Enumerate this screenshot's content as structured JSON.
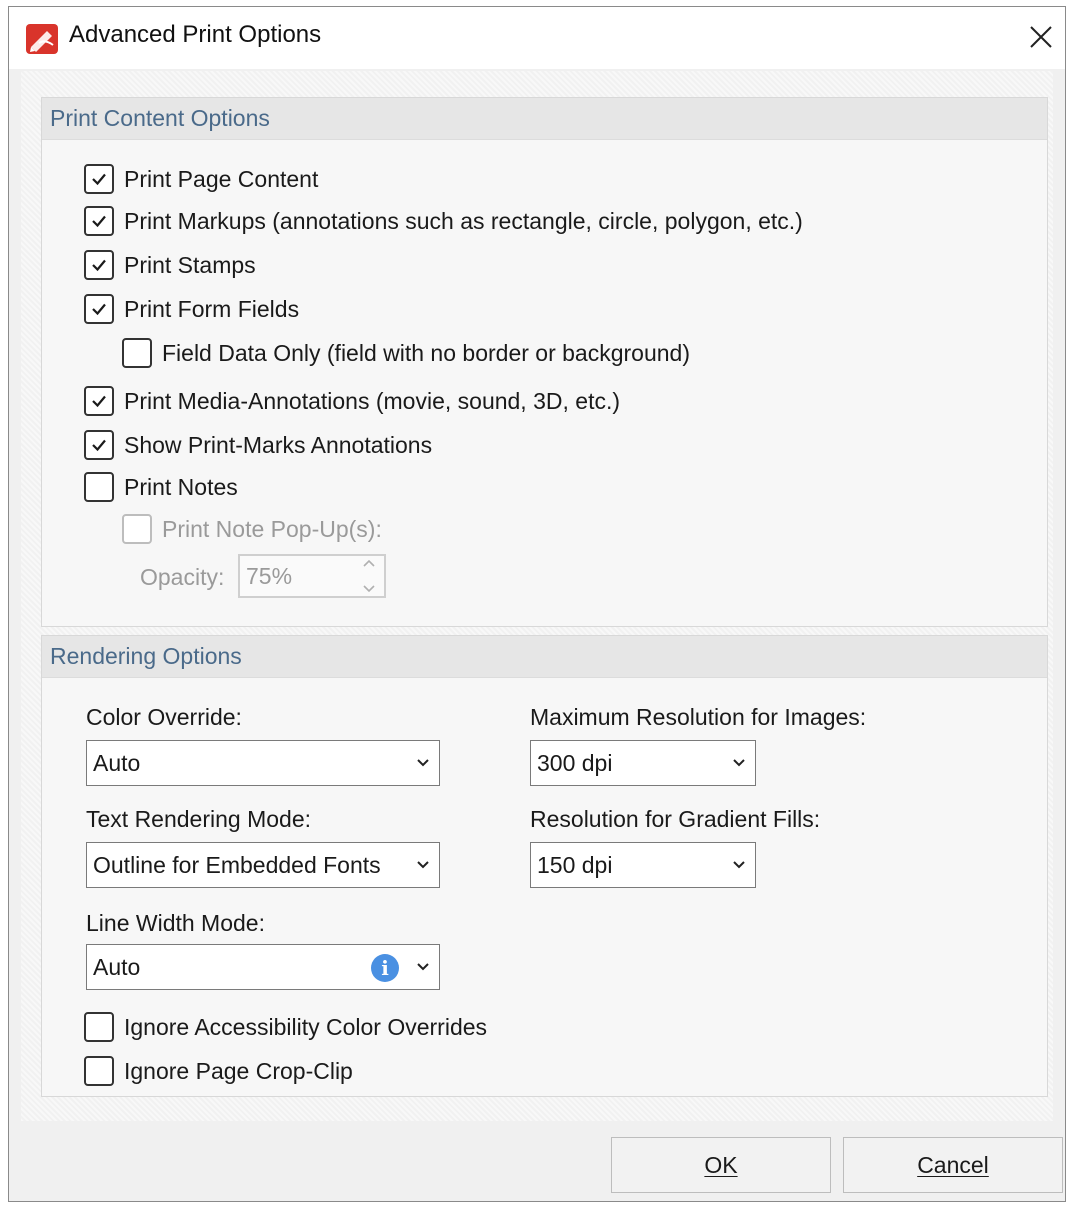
{
  "window": {
    "title": "Advanced Print Options",
    "app_icon": "pdf-app-icon",
    "close_icon": "close-icon"
  },
  "print_content": {
    "header": "Print Content Options",
    "items": [
      {
        "label": "Print Page Content",
        "checked": true,
        "disabled": false
      },
      {
        "label": "Print Markups (annotations such as rectangle, circle, polygon, etc.)",
        "checked": true,
        "disabled": false
      },
      {
        "label": "Print Stamps",
        "checked": true,
        "disabled": false
      },
      {
        "label": "Print Form Fields",
        "checked": true,
        "disabled": false
      },
      {
        "label": "Field Data Only (field with no border or background)",
        "checked": false,
        "disabled": false
      },
      {
        "label": "Print Media-Annotations (movie, sound, 3D, etc.)",
        "checked": true,
        "disabled": false
      },
      {
        "label": "Show Print-Marks Annotations",
        "checked": true,
        "disabled": false
      },
      {
        "label": "Print Notes",
        "checked": false,
        "disabled": false
      },
      {
        "label": "Print Note Pop-Up(s):",
        "checked": false,
        "disabled": true
      }
    ],
    "opacity_label": "Opacity:",
    "opacity_value": "75%"
  },
  "rendering": {
    "header": "Rendering Options",
    "color_override_label": "Color Override:",
    "color_override_value": "Auto",
    "max_res_label": "Maximum Resolution for Images:",
    "max_res_value": "300 dpi",
    "text_mode_label": "Text Rendering Mode:",
    "text_mode_value": "Outline for Embedded Fonts",
    "gradient_label": "Resolution for Gradient Fills:",
    "gradient_value": "150 dpi",
    "line_width_label": "Line Width Mode:",
    "line_width_value": "Auto",
    "info_glyph": "i",
    "ignore_accessibility_label": "Ignore Accessibility Color Overrides",
    "ignore_accessibility_checked": false,
    "ignore_crop_label": "Ignore Page Crop-Clip",
    "ignore_crop_checked": false
  },
  "buttons": {
    "ok": "OK",
    "cancel": "Cancel"
  },
  "colors": {
    "group_header_text": "#4a6a8a",
    "check_stroke": "#1a1a1a",
    "info_icon": "#4a90e2",
    "app_icon_red": "#d9342b"
  }
}
